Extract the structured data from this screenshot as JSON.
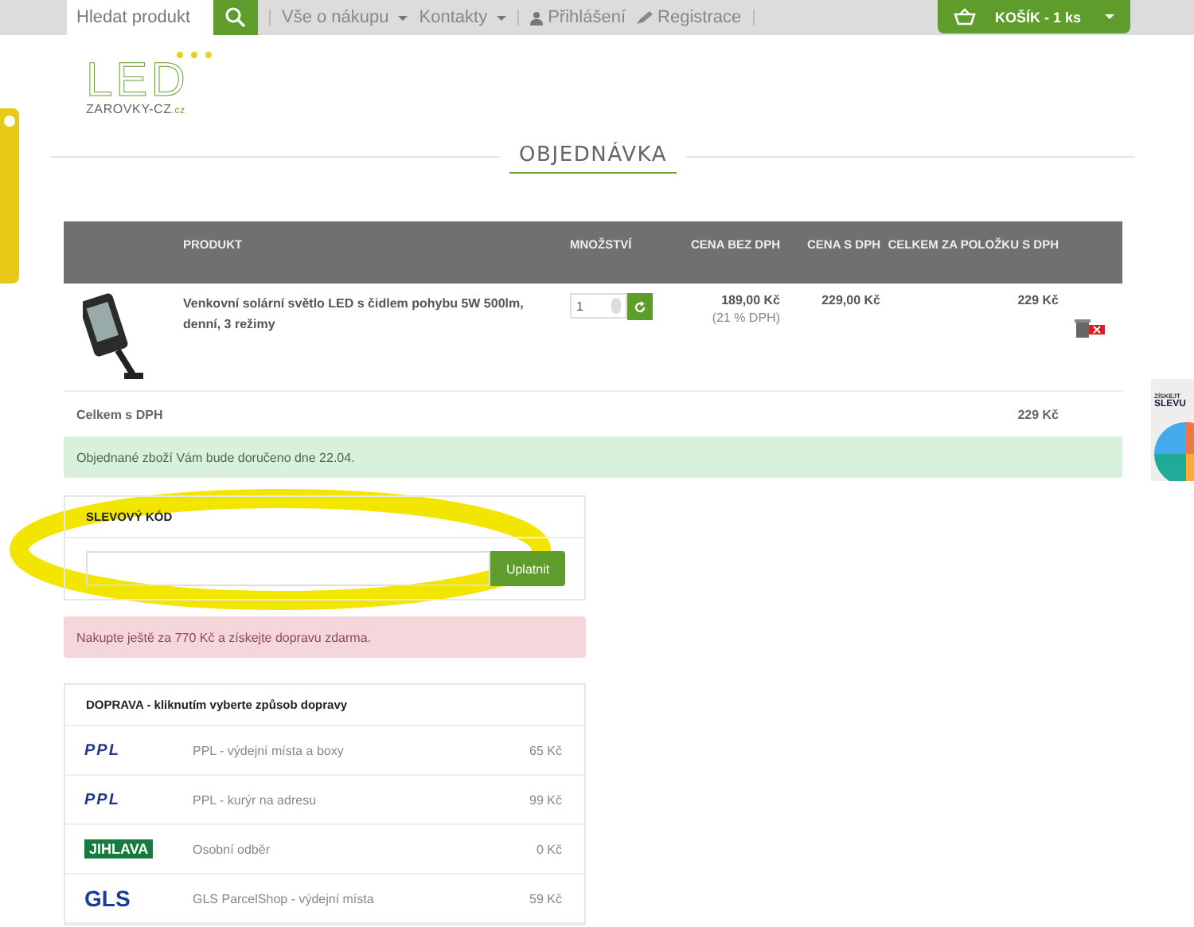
{
  "topbar": {
    "search": {
      "placeholder": "Hledat produkt"
    },
    "menu": [
      {
        "label": "Vše o nákupu",
        "dropdown": true
      },
      {
        "label": "Kontakty",
        "dropdown": true
      }
    ],
    "account": [
      {
        "kind": "user",
        "label": "Přihlášení"
      },
      {
        "kind": "pen",
        "label": "Registrace"
      }
    ],
    "cart": {
      "label": "KOŠÍK - 1 ks"
    }
  },
  "logo": {
    "main": "LED",
    "sub": "ZAROVKY-CZ",
    "tld": ".cz"
  },
  "page_title": "OBJEDNÁVKA",
  "cart_table": {
    "columns": [
      "",
      "PRODUKT",
      "MNOŽSTVÍ",
      "CENA BEZ DPH",
      "CENA S DPH",
      "CELKEM ZA POLOŽKU S DPH"
    ],
    "rows": [
      {
        "name": "Venkovní solární světlo LED s čidlem pohybu 5W 500lm, denní, 3 režimy",
        "quantity": "1",
        "price_net": "189,00 Kč",
        "vat_note": "(21 % DPH)",
        "price_gross": "229,00 Kč",
        "total": "229 Kč"
      }
    ],
    "total": {
      "label": "Celkem s DPH",
      "value": "229 Kč"
    }
  },
  "delivery_alert": "Objednané zboží Vám bude doručeno dne 22.04.",
  "discount": {
    "title": "SLEVOVÝ KÓD",
    "button": "Uplatnit"
  },
  "free_shipping_alert": "Nakupte ještě za 770 Kč a získejte dopravu zdarma.",
  "shipping": {
    "title": "DOPRAVA - kliknutím vyberte způsob dopravy",
    "options": [
      {
        "logo": {
          "kind": "ppl",
          "text": "PPL"
        },
        "name": "PPL - výdejní místa a boxy",
        "price": "65 Kč"
      },
      {
        "logo": {
          "kind": "ppl",
          "text": "PPL"
        },
        "name": "PPL - kurýr na adresu",
        "price": "99 Kč"
      },
      {
        "logo": {
          "kind": "sign",
          "text": "JIHLAVA"
        },
        "name": "Osobní odběr",
        "price": "0 Kč"
      },
      {
        "logo": {
          "kind": "gls",
          "text": "GLS"
        },
        "name": "GLS ParcelShop - výdejní místa",
        "price": "59 Kč"
      }
    ]
  },
  "promo_banner": {
    "line_1": "ZÍSKEJT",
    "line_2": "SLEVU"
  }
}
